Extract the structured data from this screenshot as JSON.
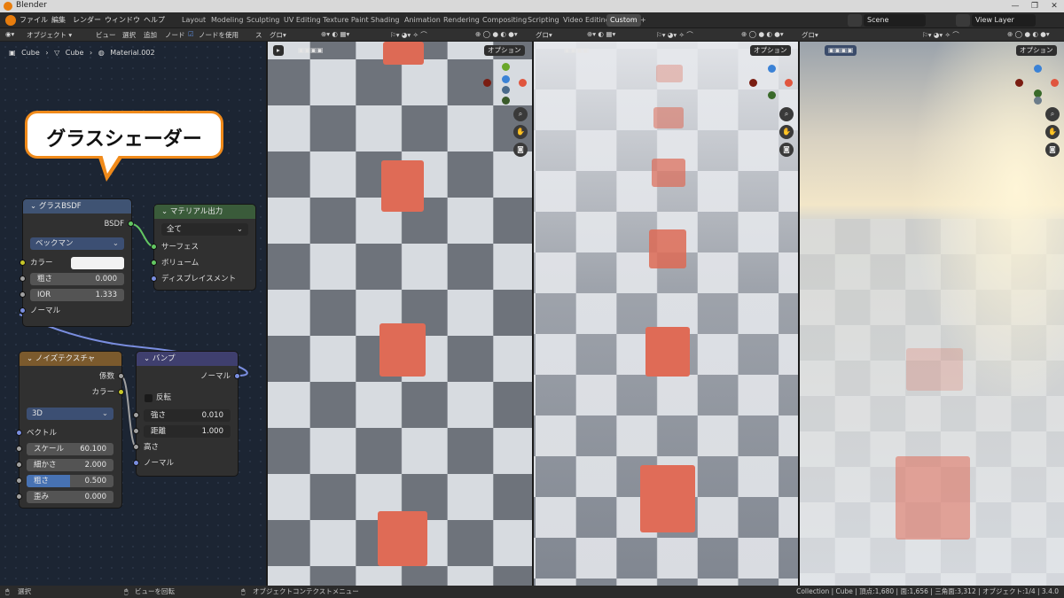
{
  "window": {
    "title": "Blender"
  },
  "menus": [
    "ファイル",
    "編集",
    "レンダー",
    "ウィンドウ",
    "ヘルプ"
  ],
  "workspaces": [
    "Layout",
    "Modeling",
    "Sculpting",
    "UV Editing",
    "Texture Paint",
    "Shading",
    "Animation",
    "Rendering",
    "Compositing",
    "Scripting",
    "Video Editing",
    "Custom",
    "+"
  ],
  "active_workspace": "Custom",
  "scene_field": "Scene",
  "viewlayer_field": "View Layer",
  "node_header": {
    "mode": "オブジェクト",
    "items": [
      "ビュー",
      "選択",
      "追加",
      "ノード"
    ],
    "use_nodes": "ノードを使用",
    "slot": "ス"
  },
  "viewport_header": {
    "shading": "グロ",
    "options": "オプション"
  },
  "breadcrumb": [
    "Cube",
    "Cube",
    "Material.002"
  ],
  "callout": "グラスシェーダー",
  "nodes": {
    "glass": {
      "title": "グラスBSDF",
      "output": "BSDF",
      "distribution": "ベックマン",
      "color_label": "カラー",
      "roughness_label": "粗さ",
      "roughness": "0.000",
      "ior_label": "IOR",
      "ior": "1.333",
      "normal_label": "ノーマル"
    },
    "output": {
      "title": "マテリアル出力",
      "target": "全て",
      "surface": "サーフェス",
      "volume": "ボリューム",
      "displacement": "ディスプレイスメント"
    },
    "noise": {
      "title": "ノイズテクスチャ",
      "fac": "係数",
      "color": "カラー",
      "dimension": "3D",
      "vector": "ベクトル",
      "scale_label": "スケール",
      "scale": "60.100",
      "detail_label": "細かさ",
      "detail": "2.000",
      "rough_label": "粗さ",
      "rough": "0.500",
      "distortion_label": "歪み",
      "distortion": "0.000"
    },
    "bump": {
      "title": "バンプ",
      "normal_out": "ノーマル",
      "invert": "反転",
      "strength_label": "強さ",
      "strength": "0.010",
      "distance_label": "距離",
      "distance": "1.000",
      "height": "高さ",
      "normal_in": "ノーマル"
    }
  },
  "status": {
    "select": "選択",
    "rotate": "ビューを回転",
    "context": "オブジェクトコンテクストメニュー",
    "stats": "Collection | Cube | 頂点:1,680 | 面:1,656 | 三角面:3,312 | オブジェクト:1/4 | 3.4.0"
  },
  "colors": {
    "accent": "#f08a1a",
    "glass_header": "#3f5373",
    "output_header": "#3a5b3a",
    "noise_header": "#7b5a2d",
    "bump_header": "#3f3f6e",
    "cube": "#e06c58"
  },
  "icons": [
    "blender-logo-icon",
    "node-editor-icon",
    "cube-icon",
    "material-icon",
    "zoom-icon",
    "hand-icon",
    "camera-icon"
  ]
}
